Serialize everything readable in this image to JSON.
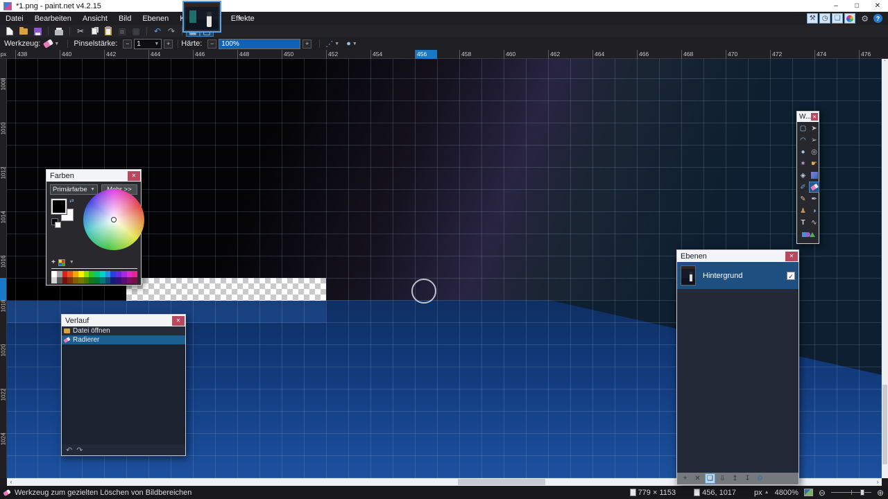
{
  "window": {
    "title": "*1.png - paint.net v4.2.15",
    "controls": [
      "minimize",
      "maximize",
      "close"
    ]
  },
  "menu": {
    "items": [
      "Datei",
      "Bearbeiten",
      "Ansicht",
      "Bild",
      "Ebenen",
      "Korrekturen",
      "Effekte"
    ]
  },
  "quick_access": {
    "buttons": [
      "tools",
      "history",
      "layers",
      "colors"
    ],
    "extra": [
      "settings",
      "help"
    ]
  },
  "toolbar": {
    "buttons": [
      {
        "icon": "new-file"
      },
      {
        "icon": "open-file"
      },
      {
        "icon": "save-file"
      },
      {
        "icon": "separator"
      },
      {
        "icon": "print"
      },
      {
        "icon": "separator"
      },
      {
        "icon": "cut"
      },
      {
        "icon": "copy"
      },
      {
        "icon": "paste"
      },
      {
        "icon": "crop",
        "disabled": true
      },
      {
        "icon": "deselect",
        "disabled": true
      },
      {
        "icon": "separator"
      },
      {
        "icon": "undo"
      },
      {
        "icon": "redo"
      },
      {
        "icon": "separator"
      },
      {
        "icon": "pixel-grid",
        "active": true
      },
      {
        "icon": "rulers",
        "active": true
      }
    ]
  },
  "tool_options": {
    "tool_label": "Werkzeug:",
    "current_tool": "eraser",
    "brush_width_label": "Pinselstärke:",
    "brush_width_value": "1",
    "hardness_label": "Härte:",
    "hardness_value": "100%"
  },
  "rulers": {
    "unit_label": "px",
    "h_ticks": [
      "438",
      "440",
      "442",
      "444",
      "446",
      "448",
      "450",
      "452",
      "454",
      "456",
      "458",
      "460",
      "462",
      "464",
      "466",
      "468",
      "470",
      "472",
      "474",
      "476"
    ],
    "h_highlight_value": "456",
    "v_ticks": [
      "1008",
      "1010",
      "1012",
      "1014",
      "1016",
      "1018",
      "1020",
      "1022",
      "1024"
    ],
    "v_highlight_value": "1017"
  },
  "canvas": {
    "base_black": "#040406",
    "purple": "#282442",
    "teal": "#0d1f30",
    "blue_top": "#0e2f63",
    "blue_mid": "#123a7c",
    "blue_bottom": "#1c509f",
    "grid_line": "rgba(160,185,205,0.20)"
  },
  "colors_window": {
    "title": "Farben",
    "mode_dropdown": "Primärfarbe",
    "more_button": "Mehr >>",
    "primary_color": "#000000",
    "secondary_color": "#ffffff",
    "palette_row1": [
      "#ffffff",
      "#a6a6a6",
      "#e02020",
      "#e85818",
      "#f0a800",
      "#f8f000",
      "#90e000",
      "#28c828",
      "#00c878",
      "#00d0d0",
      "#2890e8",
      "#2840e0",
      "#6828e0",
      "#a828e0",
      "#e028d0",
      "#e02890"
    ],
    "palette_row2": [
      "#d4d4d4",
      "#565656",
      "#781010",
      "#803008",
      "#806000",
      "#787800",
      "#487800",
      "#147814",
      "#00783c",
      "#007878",
      "#144878",
      "#102078",
      "#341078",
      "#581078",
      "#781068",
      "#781048"
    ]
  },
  "history_window": {
    "title": "Verlauf",
    "items": [
      {
        "icon": "folder",
        "label": "Datei öffnen",
        "selected": false
      },
      {
        "icon": "eraser",
        "label": "Radierer",
        "selected": true
      }
    ]
  },
  "layers_window": {
    "title": "Ebenen",
    "layers": [
      {
        "name": "Hintergrund",
        "visible": true
      }
    ],
    "buttons": [
      "add-layer",
      "delete-layer",
      "duplicate-layer",
      "merge-layer-down",
      "move-layer-up",
      "move-layer-down",
      "layer-properties"
    ],
    "active_button": "duplicate-layer"
  },
  "tools_window": {
    "title": "W...",
    "selected": "eraser",
    "tools": [
      "rectangle-select",
      "move-pixels",
      "lasso-select",
      "move-selection",
      "ellipse-select",
      "zoom",
      "magic-wand",
      "pan",
      "paint-bucket",
      "gradient",
      "paintbrush",
      "eraser",
      "pencil",
      "color-picker",
      "clone-stamp",
      "recolor",
      "text",
      "line-curve",
      "shapes"
    ]
  },
  "status_bar": {
    "tool_hint": "Werkzeug zum gezielten Löschen von Bildbereichen",
    "image_size": "779 × 1153",
    "cursor_position": "456, 1017",
    "unit": "px",
    "zoom_level": "4800%"
  }
}
